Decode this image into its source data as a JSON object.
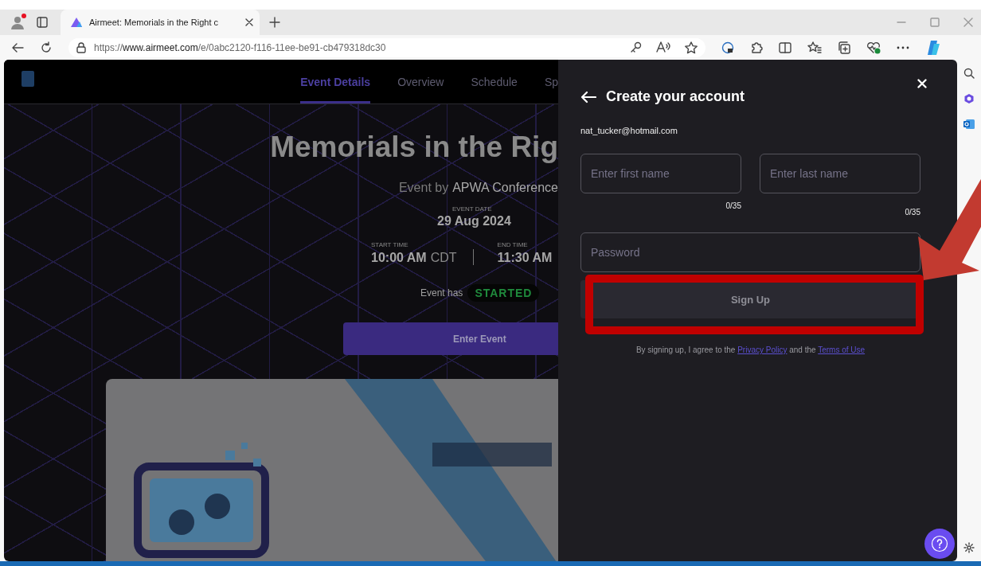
{
  "browser": {
    "tab": {
      "title": "Airmeet: Memorials in the Right c"
    },
    "address": {
      "scheme": "https://",
      "domain": "www.airmeet.com",
      "path": "/e/0abc2120-f116-11ee-be91-cb479318dc30"
    }
  },
  "event_nav": {
    "tabs": [
      {
        "label": "Event Details",
        "selected": true
      },
      {
        "label": "Overview",
        "selected": false
      },
      {
        "label": "Schedule",
        "selected": false
      },
      {
        "label": "Sp",
        "selected": false
      }
    ]
  },
  "hero": {
    "title": "Memorials in the Rig",
    "organizer_prefix": "Event by",
    "organizer": "APWA Conference",
    "date_label": "EVENT DATE",
    "date": "29 Aug 2024",
    "start_label": "START TIME",
    "start_time": "10:00 AM",
    "start_zone": "CDT",
    "end_label": "END TIME",
    "end_time": "11:30 AM",
    "status_prefix": "Event has",
    "status": "STARTED",
    "enter_button": "Enter Event"
  },
  "signup": {
    "title": "Create your account",
    "email": "nat_tucker@hotmail.com",
    "fields": [
      {
        "placeholder": "Enter first name",
        "counter": "0/35"
      },
      {
        "placeholder": "Enter last name",
        "counter": "0/35"
      }
    ],
    "password": {
      "placeholder": "Password"
    },
    "submit": "Sign Up",
    "consent": {
      "before": "By signing up, I agree to the",
      "privacy": "Privacy Policy",
      "middle": "and the",
      "terms": "Terms of Use"
    }
  }
}
